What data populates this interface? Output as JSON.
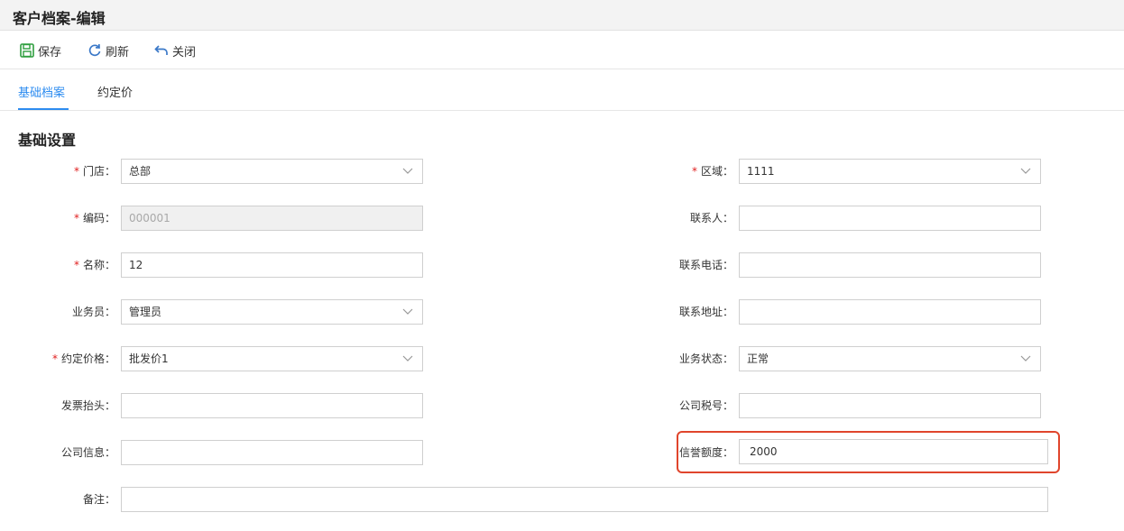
{
  "window": {
    "title": "客户档案-编辑"
  },
  "toolbar": {
    "save_label": "保存",
    "refresh_label": "刷新",
    "close_label": "关闭"
  },
  "tabs": {
    "basic": "基础档案",
    "price": "约定价"
  },
  "section": {
    "title": "基础设置"
  },
  "form": {
    "store": {
      "label": "门店：",
      "value": "总部",
      "required": true
    },
    "region": {
      "label": "区域：",
      "value": "1111",
      "required": true
    },
    "code": {
      "label": "编码：",
      "value": "000001",
      "required": true
    },
    "contact": {
      "label": "联系人：",
      "value": ""
    },
    "name": {
      "label": "名称：",
      "value": "12",
      "required": true
    },
    "phone": {
      "label": "联系电话：",
      "value": ""
    },
    "salesman": {
      "label": "业务员：",
      "value": "管理员"
    },
    "address": {
      "label": "联系地址：",
      "value": ""
    },
    "price_level": {
      "label": "约定价格：",
      "value": "批发价1",
      "required": true
    },
    "status": {
      "label": "业务状态：",
      "value": "正常"
    },
    "invoice_title": {
      "label": "发票抬头：",
      "value": ""
    },
    "tax_no": {
      "label": "公司税号：",
      "value": ""
    },
    "company_info": {
      "label": "公司信息：",
      "value": ""
    },
    "credit": {
      "label": "信誉额度：",
      "value": "2000"
    },
    "remark": {
      "label": "备注：",
      "value": ""
    }
  },
  "required_mark": "*",
  "colors": {
    "accent": "#2d8cf0",
    "required": "#e02020",
    "highlight": "#e0452c",
    "save_icon": "#2e9e3e"
  },
  "icons": {
    "save": "save-icon",
    "refresh": "refresh-icon",
    "close": "undo-icon",
    "dropdown": "chevron-down-icon"
  }
}
